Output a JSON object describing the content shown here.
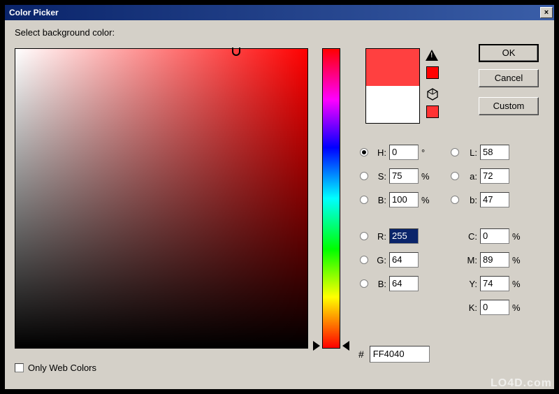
{
  "window": {
    "title": "Color Picker",
    "close_glyph": "×"
  },
  "prompt": "Select background color:",
  "buttons": {
    "ok": "OK",
    "cancel": "Cancel",
    "custom": "Custom"
  },
  "preview": {
    "new_color": "#ff4040",
    "old_color": "#ffffff",
    "warn_swatch": "#ff0000",
    "cube_swatch": "#ff3333"
  },
  "hsb": {
    "h": {
      "label": "H:",
      "value": "0",
      "unit": "°",
      "selected": true
    },
    "s": {
      "label": "S:",
      "value": "75",
      "unit": "%",
      "selected": false
    },
    "b": {
      "label": "B:",
      "value": "100",
      "unit": "%",
      "selected": false
    }
  },
  "lab": {
    "l": {
      "label": "L:",
      "value": "58",
      "selected": false
    },
    "a": {
      "label": "a:",
      "value": "72",
      "selected": false
    },
    "b": {
      "label": "b:",
      "value": "47",
      "selected": false
    }
  },
  "rgb": {
    "r": {
      "label": "R:",
      "value": "255",
      "highlighted": true
    },
    "g": {
      "label": "G:",
      "value": "64"
    },
    "b": {
      "label": "B:",
      "value": "64"
    }
  },
  "cmyk": {
    "c": {
      "label": "C:",
      "value": "0",
      "unit": "%"
    },
    "m": {
      "label": "M:",
      "value": "89",
      "unit": "%"
    },
    "y": {
      "label": "Y:",
      "value": "74",
      "unit": "%"
    },
    "k": {
      "label": "K:",
      "value": "0",
      "unit": "%"
    }
  },
  "hex": {
    "prefix": "#",
    "value": "FF4040"
  },
  "web_colors": {
    "label": "Only Web Colors",
    "checked": false
  },
  "watermark": "LO4D.com"
}
